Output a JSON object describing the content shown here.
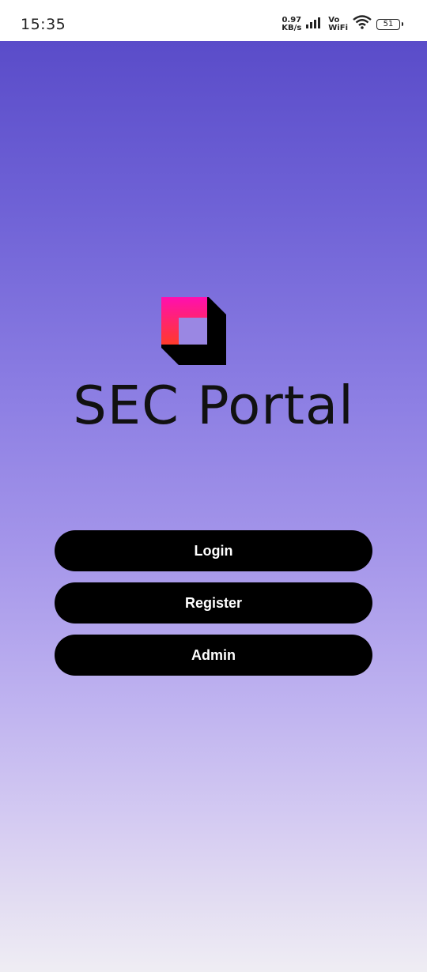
{
  "status_bar": {
    "time": "15:35",
    "net_speed_value": "0.97",
    "net_speed_unit": "KB/s",
    "vo_label": "Vo",
    "wifi_label": "WiFi",
    "battery_level": "51",
    "icons": [
      "signal-icon",
      "wifi-icon",
      "battery-icon"
    ]
  },
  "app": {
    "brand_name": "SEC Portal",
    "logo_icon": "sec-portal-logo",
    "buttons": {
      "login": "Login",
      "register": "Register",
      "admin": "Admin"
    }
  },
  "colors": {
    "gradient_top": "#5a4cc9",
    "gradient_bottom": "#efedf3",
    "button_bg": "#000000",
    "button_text": "#ffffff",
    "logo_pink": "#ff0fb0",
    "logo_orange": "#ff3a2a"
  }
}
